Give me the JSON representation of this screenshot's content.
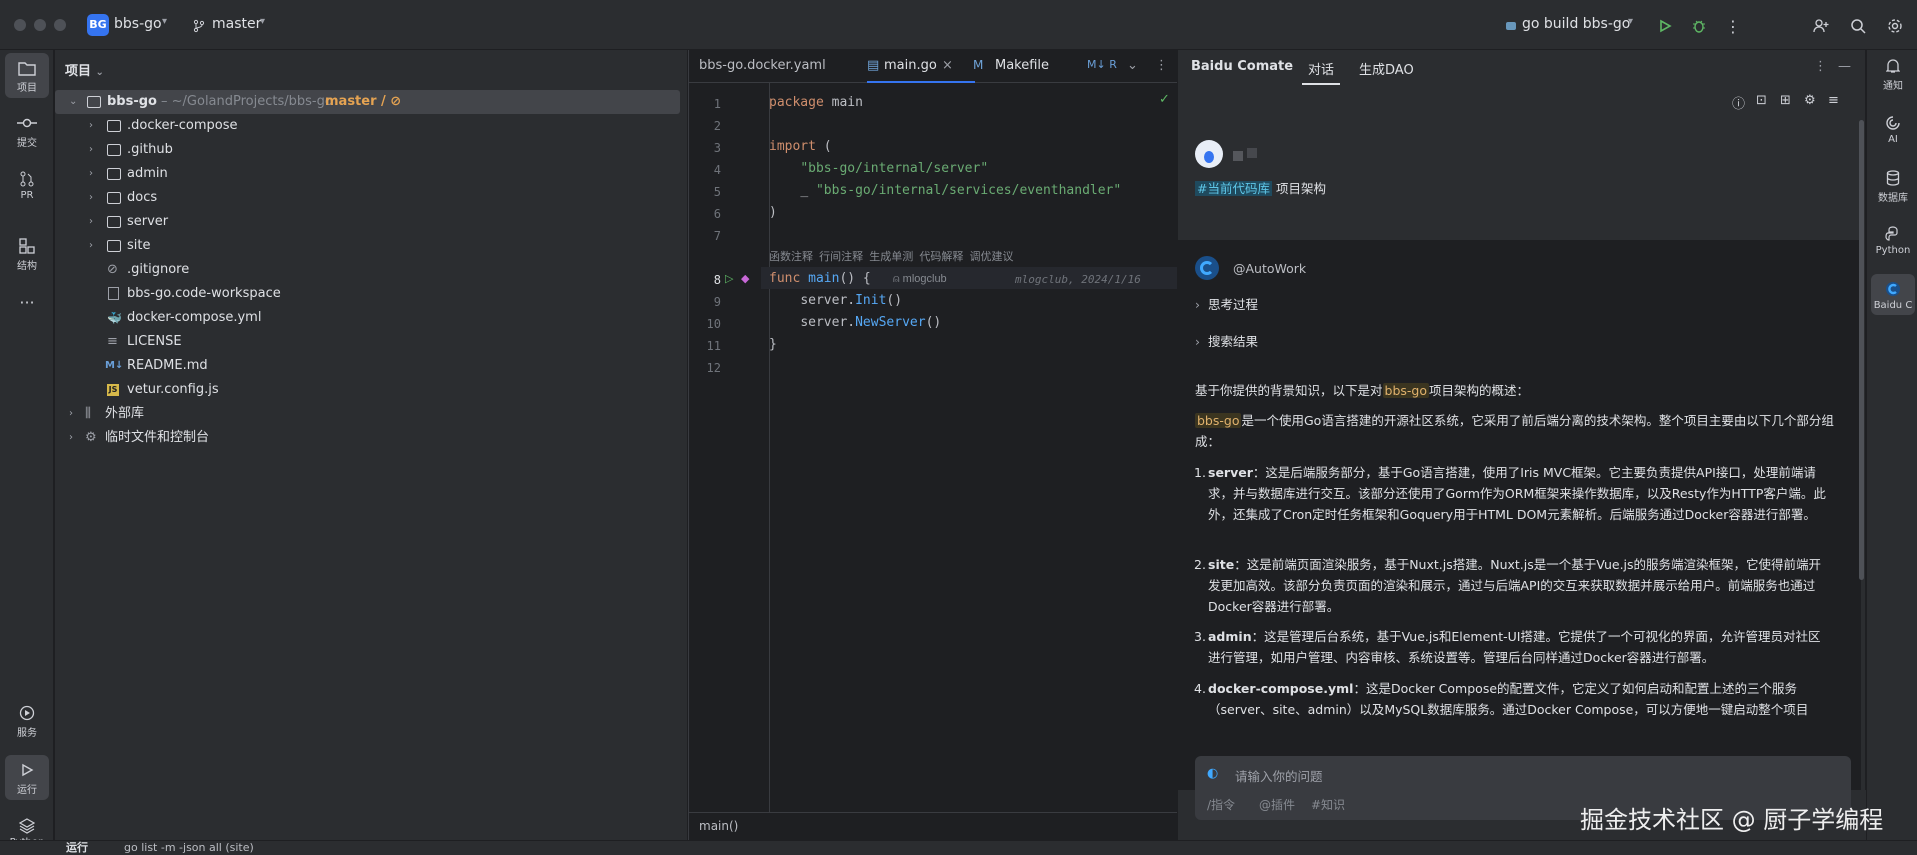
{
  "titlebar": {
    "project_badge": "BG",
    "project_name": "bbs-go",
    "branch": "master",
    "run_config": "go build bbs-go"
  },
  "left_strip": [
    {
      "label": "项目",
      "icon": "folder-icon"
    },
    {
      "label": "提交",
      "icon": "commit-icon"
    },
    {
      "label": "PR",
      "icon": "pull-request-icon"
    },
    {
      "label": "结构",
      "icon": "structure-icon"
    },
    {
      "label": "",
      "icon": "more-icon"
    },
    {
      "label": "服务",
      "icon": "services-icon"
    },
    {
      "label": "运行",
      "icon": "run-icon"
    },
    {
      "label": "Python",
      "icon": "python-packages-icon"
    }
  ],
  "project_panel": {
    "title": "项目",
    "root": {
      "name": "bbs-go",
      "path": "~/GolandProjects/bbs-go",
      "branch": "master / ⊘"
    },
    "items": [
      {
        "name": ".docker-compose",
        "type": "folder"
      },
      {
        "name": ".github",
        "type": "folder"
      },
      {
        "name": "admin",
        "type": "folder"
      },
      {
        "name": "docs",
        "type": "folder"
      },
      {
        "name": "server",
        "type": "folder"
      },
      {
        "name": "site",
        "type": "folder"
      },
      {
        "name": ".gitignore",
        "type": "ignore"
      },
      {
        "name": "bbs-go.code-workspace",
        "type": "file"
      },
      {
        "name": "docker-compose.yml",
        "type": "docker"
      },
      {
        "name": "LICENSE",
        "type": "text"
      },
      {
        "name": "README.md",
        "type": "md"
      },
      {
        "name": "vetur.config.js",
        "type": "js"
      }
    ],
    "external": "外部库",
    "scratches": "临时文件和控制台"
  },
  "editor": {
    "tabs": [
      "bbs-go.docker.yaml",
      "main.go",
      "Makefile",
      "M↓ R"
    ],
    "line_numbers": [
      "1",
      "2",
      "3",
      "4",
      "5",
      "6",
      "7",
      "8",
      "9",
      "10",
      "11",
      "12"
    ],
    "inlay_actions": "函数注释  行间注释  生成单测  代码解释  调优建议",
    "author_hint": "mlogclub",
    "blame": "mlogclub, 2024/1/16",
    "breadcrumb": "main()"
  },
  "comate": {
    "title": "Baidu Comate",
    "tabs": [
      "对话",
      "生成DAO"
    ],
    "user_tag": "#当前代码库",
    "user_query": "项目架构",
    "agent": "@AutoWork",
    "thinking": "思考过程",
    "search_results": "搜索结果",
    "intro_pre": "基于你提供的背景知识，以下是对",
    "intro_hl": "bbs-go",
    "intro_post": "项目架构的概述：",
    "desc_hl": "bbs-go",
    "desc": "是一个使用Go语言搭建的开源社区系统，它采用了前后端分离的技术架构。整个项目主要由以下几个部分组成：",
    "items": [
      {
        "num": "1.",
        "name": "server",
        "text": "：这是后端服务部分，基于Go语言搭建，使用了Iris MVC框架。它主要负责提供API接口，处理前端请求，并与数据库进行交互。该部分还使用了Gorm作为ORM框架来操作数据库，以及Resty作为HTTP客户端。此外，还集成了Cron定时任务框架和Goquery用于HTML DOM元素解析。后端服务通过Docker容器进行部署。"
      },
      {
        "num": "2.",
        "name": "site",
        "text": "：这是前端页面渲染服务，基于Nuxt.js搭建。Nuxt.js是一个基于Vue.js的服务端渲染框架，它使得前端开发更加高效。该部分负责页面的渲染和展示，通过与后端API的交互来获取数据并展示给用户。前端服务也通过Docker容器进行部署。"
      },
      {
        "num": "3.",
        "name": "admin",
        "text": "：这是管理后台系统，基于Vue.js和Element-UI搭建。它提供了一个可视化的界面，允许管理员对社区进行管理，如用户管理、内容审核、系统设置等。管理后台同样通过Docker容器进行部署。"
      },
      {
        "num": "4.",
        "name": "docker-compose.yml",
        "text": "：这是Docker Compose的配置文件，它定义了如何启动和配置上述的三个服务（server、site、admin）以及MySQL数据库服务。通过Docker Compose，可以方便地一键启动整个项目"
      }
    ],
    "input_placeholder": "请输入你的问题",
    "input_hints": [
      "/指令",
      "@插件",
      "#知识"
    ]
  },
  "right_strip": [
    {
      "label": "通知",
      "icon": "bell-icon"
    },
    {
      "label": "AI",
      "icon": "ai-icon"
    },
    {
      "label": "数据库",
      "icon": "database-icon"
    },
    {
      "label": "Python",
      "icon": "python-console-icon"
    },
    {
      "label": "Baidu C",
      "icon": "comate-icon"
    }
  ],
  "bottom": {
    "tab": "运行",
    "run_item": "go list -m -json all (site)"
  },
  "watermark": "掘金技术社区 @ 厨子学编程",
  "colors": {
    "accent": "#3574f0",
    "run_green": "#5fb865",
    "keyword": "#cf8e6d",
    "string": "#6aab73",
    "function": "#56a8f5"
  }
}
